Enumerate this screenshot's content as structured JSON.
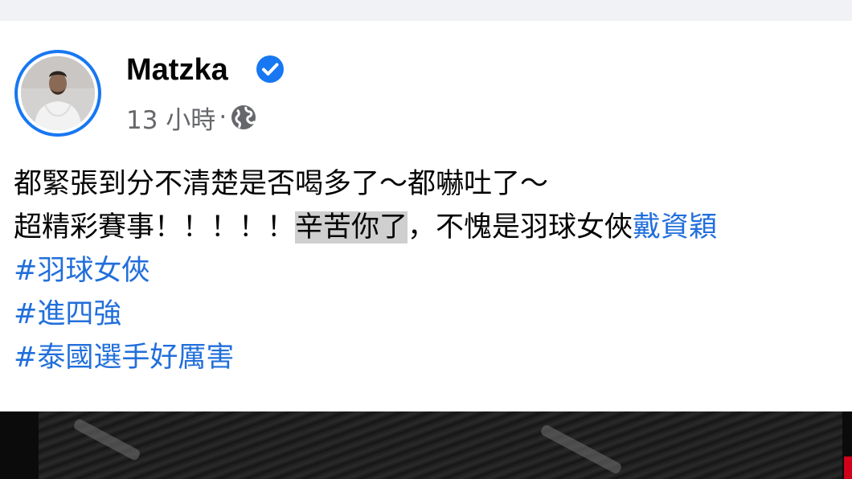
{
  "post": {
    "author": {
      "name": "Matzka",
      "verified": true,
      "avatar_icon": "person-avatar",
      "ring_color": "#1877f2"
    },
    "time": "13 小時",
    "separator": "·",
    "privacy_icon": "globe-icon",
    "text": {
      "line1": "都緊張到分不清楚是否喝多了～都嚇吐了～",
      "line2_part1": "超精彩賽事！！！！！",
      "line2_highlight": "辛苦你了",
      "line2_part2": "，不愧是羽球女俠",
      "line2_mention": "戴資穎"
    },
    "hashtags": [
      "#羽球女俠",
      "#進四強",
      "#泰國選手好厲害"
    ]
  },
  "colors": {
    "link": "#216fdb",
    "text": "#050505",
    "meta": "#65676b",
    "background": "#f0f2f5",
    "verified": "#1877f2"
  }
}
